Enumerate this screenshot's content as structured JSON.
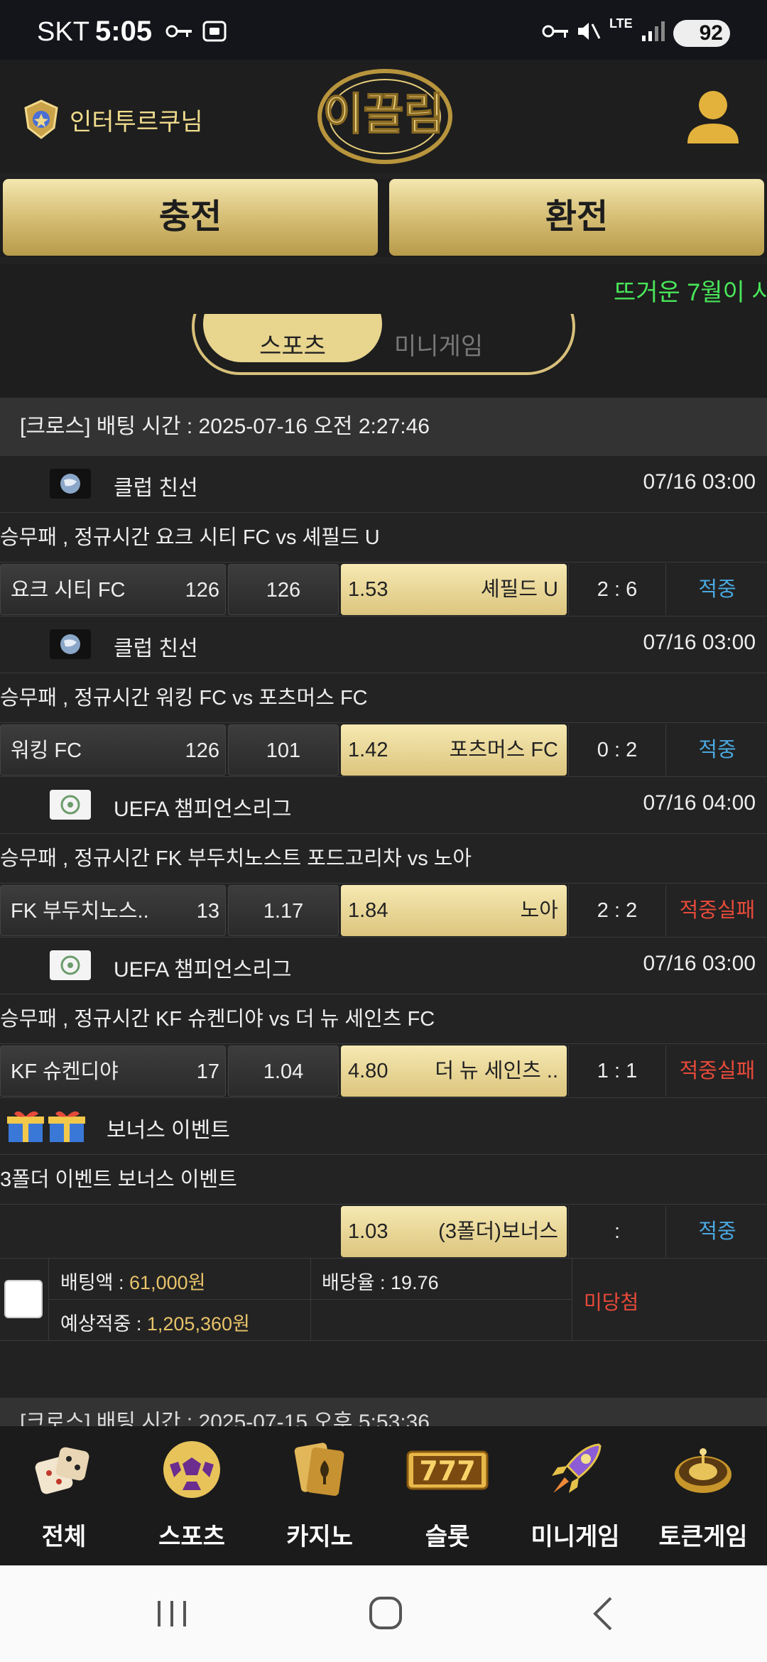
{
  "status_bar": {
    "carrier": "SKT",
    "time": "5:05",
    "battery": "92",
    "network": "LTE"
  },
  "header": {
    "username": "인터투르쿠님",
    "logo_text": "이끌림"
  },
  "buttons": {
    "charge": "충전",
    "exchange": "환전"
  },
  "ticker": {
    "text": "뜨거운 7월이 시"
  },
  "tabs": {
    "active": "스포츠",
    "inactive": "미니게임"
  },
  "bet": {
    "header": "[크로스] 배팅 시간 : 2025-07-16 오전 2:27:46",
    "matches": [
      {
        "league": "클럽 친선",
        "time": "07/16 03:00",
        "title": "승무패 , 정규시간 요크 시티 FC  vs  셰필드 U",
        "home": "요크 시티 FC",
        "home_odds": "126",
        "draw_odds": "126",
        "away_odds": "1.53",
        "away": "셰필드 U",
        "score": "2 : 6",
        "result": "적중",
        "result_type": "hit"
      },
      {
        "league": "클럽 친선",
        "time": "07/16 03:00",
        "title": "승무패 , 정규시간 워킹 FC  vs  포츠머스 FC",
        "home": "워킹 FC",
        "home_odds": "126",
        "draw_odds": "101",
        "away_odds": "1.42",
        "away": "포츠머스 FC",
        "score": "0 : 2",
        "result": "적중",
        "result_type": "hit"
      },
      {
        "league": "UEFA 챔피언스리그",
        "time": "07/16 04:00",
        "title": "승무패 , 정규시간 FK 부두치노스트 포드고리차  vs  노아",
        "home": "FK 부두치노스..",
        "home_odds": "13",
        "draw_odds": "1.17",
        "away_odds": "1.84",
        "away": "노아",
        "score": "2 : 2",
        "result": "적중실패",
        "result_type": "miss"
      },
      {
        "league": "UEFA 챔피언스리그",
        "time": "07/16 03:00",
        "title": "승무패 , 정규시간 KF 슈켄디야  vs  더 뉴 세인츠 FC",
        "home": "KF 슈켄디야",
        "home_odds": "17",
        "draw_odds": "1.04",
        "away_odds": "4.80",
        "away": "더 뉴 세인츠 ..",
        "score": "1 : 1",
        "result": "적중실패",
        "result_type": "miss"
      }
    ],
    "bonus": {
      "league": "보너스 이벤트",
      "title": "3폴더 이벤트 보너스 이벤트",
      "away_odds": "1.03",
      "away": "(3폴더)보너스",
      "score": ":",
      "result": "적중"
    },
    "summary": {
      "bet_amount_label": "배팅액 : ",
      "bet_amount": "61,000원",
      "odds_label": "배당율 : ",
      "odds": "19.76",
      "expected_label": "예상적중 : ",
      "expected": "1,205,360원",
      "status": "미당첨"
    },
    "next_header": "[크로스] 배팅 시간 : 2025-07-15 오후 5:53:36"
  },
  "bottom_nav": [
    {
      "label": "전체",
      "icon": "dice-icon"
    },
    {
      "label": "스포츠",
      "icon": "soccer-ball-icon"
    },
    {
      "label": "카지노",
      "icon": "cards-icon"
    },
    {
      "label": "슬롯",
      "icon": "slot-777-icon"
    },
    {
      "label": "미니게임",
      "icon": "rocket-icon"
    },
    {
      "label": "토큰게임",
      "icon": "roulette-icon"
    }
  ],
  "colors": {
    "gold": "#dcc57e",
    "hit": "#4aa8e0",
    "miss": "#e84a3a",
    "ticker": "#49e65a"
  }
}
